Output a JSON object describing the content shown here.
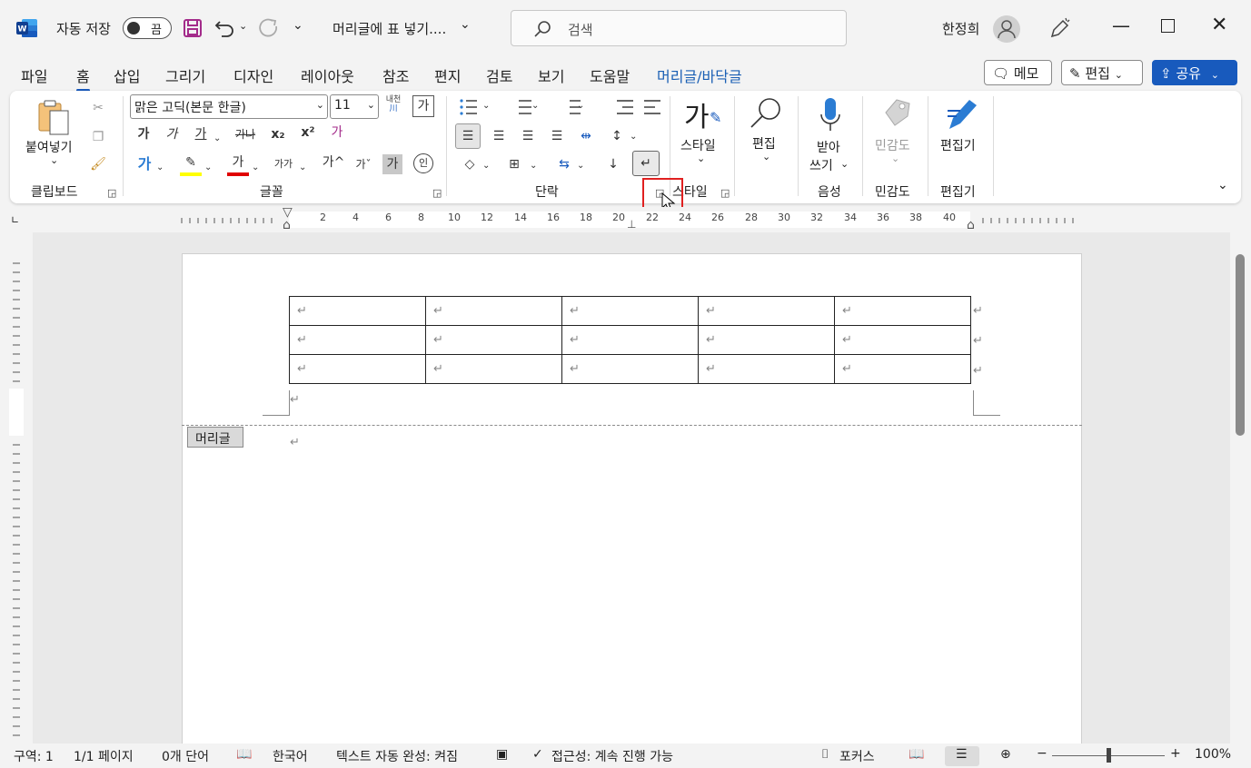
{
  "titlebar": {
    "autosave_label": "자동 저장",
    "autosave_state": "끔",
    "document_title": "머리글에 표 넣기....",
    "search_placeholder": "검색",
    "user_name": "한정희"
  },
  "tabs": [
    "파일",
    "홈",
    "삽입",
    "그리기",
    "디자인",
    "레이아웃",
    "참조",
    "편지",
    "검토",
    "보기",
    "도움말",
    "머리글/바닥글"
  ],
  "active_tab": "홈",
  "right_buttons": {
    "memo": "메모",
    "edit": "편집",
    "share": "공유"
  },
  "ribbon": {
    "clipboard": {
      "paste": "붙여넣기",
      "label": "클립보드"
    },
    "font": {
      "name": "맑은 고딕(본문 한글)",
      "size": "11",
      "label": "글꼴",
      "bold": "가",
      "italic": "가",
      "underline": "가",
      "strike": "가나",
      "sub": "x₂",
      "sup": "x²",
      "clear": "가",
      "effect": "가",
      "highlight": "가",
      "color": "가",
      "case": "가가",
      "grow": "가^",
      "shrink": "가ˇ",
      "shade": "가",
      "enclose": "인",
      "phonetic_top": "내천",
      "phonetic_bottom": "川",
      "charborder": "가"
    },
    "paragraph": {
      "label": "단락"
    },
    "styles": {
      "button": "스타일",
      "label": "스타일"
    },
    "editing": {
      "button": "편집"
    },
    "voice": {
      "button_line1": "받아",
      "button_line2": "쓰기",
      "label": "음성"
    },
    "sensitivity": {
      "button": "민감도",
      "label": "민감도"
    },
    "editor": {
      "button": "편집기",
      "label": "편집기"
    }
  },
  "ruler_numbers": [
    "2",
    "4",
    "6",
    "8",
    "10",
    "12",
    "14",
    "16",
    "18",
    "20",
    "22",
    "24",
    "26",
    "28",
    "30",
    "32",
    "34",
    "36",
    "38",
    "40"
  ],
  "document": {
    "table": {
      "rows": 3,
      "cols": 5
    },
    "para_mark": "↵",
    "header_tag": "머리글"
  },
  "statusbar": {
    "section": "구역: 1",
    "page": "1/1 페이지",
    "words": "0개 단어",
    "language": "한국어",
    "autocomplete": "텍스트 자동 완성: 켜짐",
    "accessibility": "접근성: 계속 진행 가능",
    "focus": "포커스",
    "zoom": "100%"
  }
}
